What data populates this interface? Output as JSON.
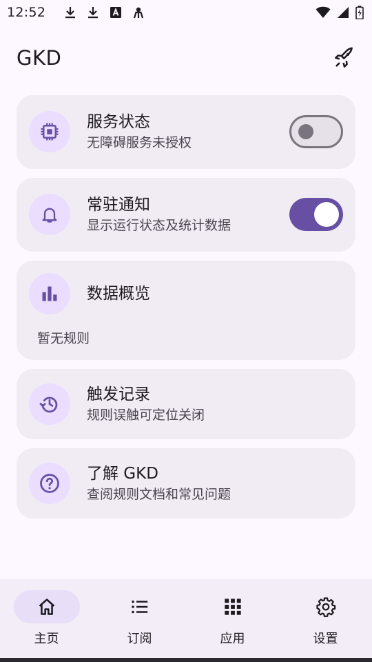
{
  "status_bar": {
    "time": "12:52",
    "left_icons": [
      "download-icon",
      "download-icon",
      "font-icon",
      "android-debug-icon"
    ],
    "right_icons": [
      "wifi-icon",
      "cell-signal-icon",
      "battery-icon"
    ]
  },
  "app_bar": {
    "title": "GKD",
    "action_icon": "rocket-icon"
  },
  "cards": {
    "service": {
      "icon": "chip-icon",
      "title": "服务状态",
      "subtitle": "无障碍服务未授权",
      "switch_on": false
    },
    "notification": {
      "icon": "bell-icon",
      "title": "常驻通知",
      "subtitle": "显示运行状态及统计数据",
      "switch_on": true
    },
    "overview": {
      "icon": "bar-chart-icon",
      "title": "数据概览",
      "note": "暂无规则"
    },
    "records": {
      "icon": "history-icon",
      "title": "触发记录",
      "subtitle": "规则误触可定位关闭"
    },
    "about": {
      "icon": "help-icon",
      "title": "了解 GKD",
      "subtitle": "查阅规则文档和常见问题"
    }
  },
  "bottom_nav": {
    "items": [
      {
        "label": "主页",
        "icon": "home-icon",
        "active": true
      },
      {
        "label": "订阅",
        "icon": "list-icon",
        "active": false
      },
      {
        "label": "应用",
        "icon": "apps-grid-icon",
        "active": false
      },
      {
        "label": "设置",
        "icon": "gear-icon",
        "active": false
      }
    ]
  },
  "colors": {
    "background": "#FDF7FF",
    "card": "#F1EBF4",
    "icon_circle": "#EADDFF",
    "primary": "#6750A4",
    "nav_background": "#F3EDF7",
    "nav_active": "#E8DEF8"
  }
}
